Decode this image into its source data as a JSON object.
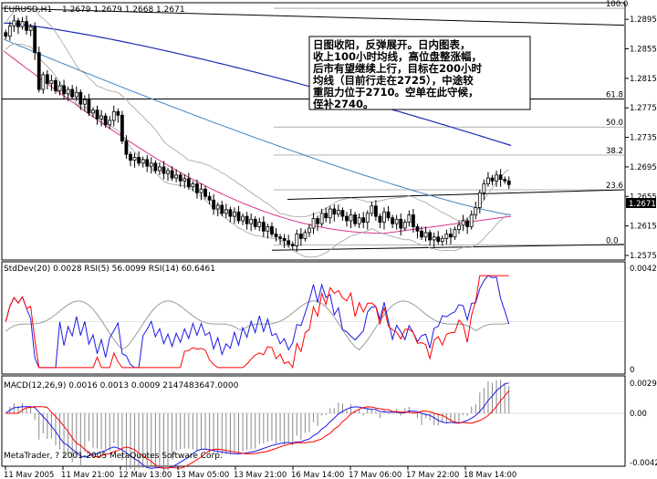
{
  "header": {
    "symbol": "EURUSD,H1",
    "ohlc": "1.2679 1.2679 1.2668 1.2671"
  },
  "current_price_label": "1.2671",
  "annotation_lines": [
    "日图收阳，反弹展开。日内图表，",
    "收上100小时均线，高位盘整涨幅，",
    "后市有望继续上行，目标在200小时",
    "均线（目前行走在2725），中途较",
    "重阻力位于2710。空单在此守候，",
    "侄补2740。"
  ],
  "footer": "MetaTrader, ? 2001-2005 MetaQuotes Software Corp.",
  "chart_data": [
    {
      "type": "candlestick",
      "panel": "main",
      "ylim": [
        1.257,
        1.2915
      ],
      "y_ticks": [
        "1.2895",
        "1.2855",
        "1.2815",
        "1.2775",
        "1.2735",
        "1.2695",
        "1.2655",
        "1.2615",
        "1.2575"
      ],
      "x_ticks": [
        "11 Mav 2005",
        "11 Mav 21:00",
        "12 Mav 13:00",
        "13 Mav 05:00",
        "13 Mav 21:00",
        "16 Mav 14:00",
        "17 Mav 06:00",
        "17 Mav 22:00",
        "18 Mav 14:00"
      ],
      "fibonacci": [
        {
          "label": "100.0",
          "value": 1.291
        },
        {
          "label": "61.8",
          "value": 1.2787
        },
        {
          "label": "50.0",
          "value": 1.2749
        },
        {
          "label": "38.2",
          "value": 1.2711
        },
        {
          "label": "23.6",
          "value": 1.2664
        },
        {
          "label": "0.0",
          "value": 1.2589
        }
      ],
      "close_series": [
        1.2872,
        1.2886,
        1.2893,
        1.2885,
        1.2892,
        1.288,
        1.2885,
        1.285,
        1.28,
        1.282,
        1.2808,
        1.2812,
        1.2798,
        1.2805,
        1.2794,
        1.28,
        1.279,
        1.2796,
        1.278,
        1.2786,
        1.2768,
        1.2772,
        1.276,
        1.2764,
        1.2752,
        1.2758,
        1.277,
        1.2765,
        1.273,
        1.2712,
        1.2704,
        1.2708,
        1.27,
        1.2705,
        1.2696,
        1.27,
        1.269,
        1.2695,
        1.2686,
        1.269,
        1.268,
        1.2684,
        1.2676,
        1.2679,
        1.2668,
        1.2672,
        1.266,
        1.2665,
        1.2655,
        1.265,
        1.2638,
        1.2643,
        1.2632,
        1.2637,
        1.2628,
        1.2634,
        1.2622,
        1.2628,
        1.2618,
        1.2624,
        1.2614,
        1.262,
        1.2608,
        1.2614,
        1.2604,
        1.26,
        1.2598,
        1.2595,
        1.259,
        1.2588,
        1.2604,
        1.2598,
        1.2606,
        1.2612,
        1.2625,
        1.2618,
        1.2632,
        1.2626,
        1.2638,
        1.2631,
        1.2636,
        1.2628,
        1.2622,
        1.263,
        1.2618,
        1.2626,
        1.262,
        1.2632,
        1.2642,
        1.2628,
        1.262,
        1.2634,
        1.2626,
        1.2618,
        1.2624,
        1.2612,
        1.262,
        1.263,
        1.2614,
        1.2608,
        1.26,
        1.2606,
        1.2596,
        1.26,
        1.2594,
        1.2598,
        1.2604,
        1.26,
        1.261,
        1.2616,
        1.2622,
        1.2614,
        1.263,
        1.264,
        1.266,
        1.2672,
        1.268,
        1.2676,
        1.2684,
        1.2678,
        1.2676,
        1.2671
      ],
      "ma_long_blue": {
        "from": 1.289,
        "to": 1.2724
      },
      "ma_mid_blue": {
        "from": 1.2868,
        "to": 1.263
      },
      "ma_pink": {
        "from": 1.2852,
        "to": 1.2628
      }
    },
    {
      "type": "line",
      "panel": "oscillators",
      "title": "StdDev(20) 0.0028  RSI(5) 56.0099  RSI(14) 60.6461",
      "y_ticks": [
        "0.0042",
        "0"
      ],
      "series": [
        {
          "name": "StdDev(20)",
          "color": "#9a9a9a",
          "last": 0.0028
        },
        {
          "name": "RSI(5)",
          "color": "#1a1ae6",
          "last": 56.0099
        },
        {
          "name": "RSI(14)",
          "color": "#ff0000",
          "last": 60.6461
        }
      ]
    },
    {
      "type": "bar",
      "panel": "macd",
      "title": "MACD(12,26,9) 0.0016 0.0013 0.0009 2147483647.0000",
      "y_ticks": [
        "0.0029",
        "0.00",
        "-0.0042"
      ],
      "series": [
        {
          "name": "MACD",
          "values": [
            0.0016
          ]
        },
        {
          "name": "Signal",
          "values": [
            0.0013
          ]
        },
        {
          "name": "Histogram",
          "values": [
            0.0009
          ]
        }
      ]
    }
  ],
  "colors": {
    "candle": "#000000",
    "ma_long": "#1c2bb0",
    "ma_mid": "#3f86c2",
    "ma_pink": "#d6338f",
    "bollinger": "#a0a0a0",
    "fibo": "#9a9a9a",
    "rsi5": "#1a1ae6",
    "rsi14": "#ff0000",
    "macd_line": "#1a1ae6",
    "signal_line": "#ff0000"
  }
}
